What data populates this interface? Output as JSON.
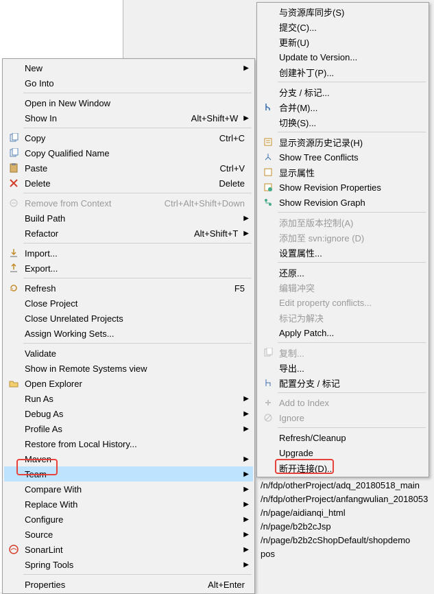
{
  "menu1": {
    "new": "New",
    "go_into": "Go Into",
    "open_new_window": "Open in New Window",
    "show_in": "Show In",
    "show_in_sc": "Alt+Shift+W",
    "copy": "Copy",
    "copy_sc": "Ctrl+C",
    "copy_qualified": "Copy Qualified Name",
    "paste": "Paste",
    "paste_sc": "Ctrl+V",
    "delete": "Delete",
    "delete_sc": "Delete",
    "remove_ctx": "Remove from Context",
    "remove_ctx_sc": "Ctrl+Alt+Shift+Down",
    "build_path": "Build Path",
    "refactor": "Refactor",
    "refactor_sc": "Alt+Shift+T",
    "import": "Import...",
    "export": "Export...",
    "refresh": "Refresh",
    "refresh_sc": "F5",
    "close_project": "Close Project",
    "close_unrelated": "Close Unrelated Projects",
    "assign_ws": "Assign Working Sets...",
    "validate": "Validate",
    "show_remote": "Show in Remote Systems view",
    "open_explorer": "Open Explorer",
    "run_as": "Run As",
    "debug_as": "Debug As",
    "profile_as": "Profile As",
    "restore_local": "Restore from Local History...",
    "maven": "Maven",
    "team": "Team",
    "compare_with": "Compare With",
    "replace_with": "Replace With",
    "configure": "Configure",
    "source": "Source",
    "sonarlint": "SonarLint",
    "spring_tools": "Spring Tools",
    "properties": "Properties",
    "properties_sc": "Alt+Enter"
  },
  "menu2": {
    "sync": "与资源库同步(S)",
    "commit": "提交(C)...",
    "update": "更新(U)",
    "update_to_version": "Update to Version...",
    "create_patch": "创建补丁(P)...",
    "branch_tag": "分支 / 标记...",
    "merge": "合并(M)...",
    "switch": "切换(S)...",
    "show_history": "显示资源历史记录(H)",
    "show_tree_conflicts": "Show Tree Conflicts",
    "show_props": "显示属性",
    "show_revprops": "Show Revision Properties",
    "show_revgraph": "Show Revision Graph",
    "add_to_vc": "添加至版本控制(A)",
    "add_to_ignore": "添加至 svn:ignore (D)",
    "set_props": "设置属性...",
    "revert": "还原...",
    "edit_conflict": "编辑冲突",
    "edit_prop_conflicts": "Edit property conflicts...",
    "mark_resolved": "标记为解决",
    "apply_patch": "Apply Patch...",
    "copy": "复制...",
    "export": "导出...",
    "config_branch": "配置分支 / 标记",
    "add_to_index": "Add to Index",
    "ignore": "Ignore",
    "refresh_cleanup": "Refresh/Cleanup",
    "upgrade": "Upgrade",
    "disconnect": "断开连接(D)..."
  },
  "bg": {
    "l1": "/n/fdp/otherProject/adq_20180518_main",
    "l2": "/n/fdp/otherProject/anfangwulian_2018053",
    "l3": "/n/page/aidianqi_html",
    "l4": "/n/page/b2b2cJsp",
    "l5": "/n/page/b2b2cShopDefault/shopdemo",
    "l6": "pos"
  }
}
